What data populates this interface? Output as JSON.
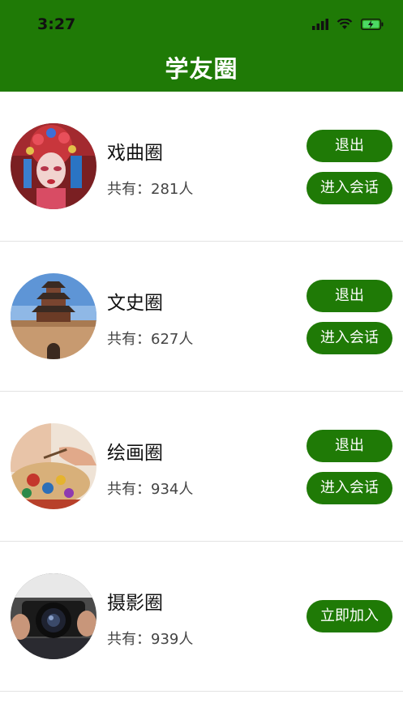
{
  "status_bar": {
    "time": "3:27"
  },
  "header": {
    "title": "学友圈"
  },
  "circles": [
    {
      "name": "戏曲圈",
      "count": "共有：281人",
      "buttons": [
        "退出",
        "进入会话"
      ],
      "avatar_icon": "peking-opera-photo"
    },
    {
      "name": "文史圈",
      "count": "共有：627人",
      "buttons": [
        "退出",
        "进入会话"
      ],
      "avatar_icon": "ancient-tower-photo"
    },
    {
      "name": "绘画圈",
      "count": "共有：934人",
      "buttons": [
        "退出",
        "进入会话"
      ],
      "avatar_icon": "painting-palette-photo"
    },
    {
      "name": "摄影圈",
      "count": "共有：939人",
      "buttons": [
        "立即加入"
      ],
      "avatar_icon": "camera-photo"
    }
  ],
  "colors": {
    "brand_green": "#1f7a06",
    "separator": "#e3e3e3"
  }
}
